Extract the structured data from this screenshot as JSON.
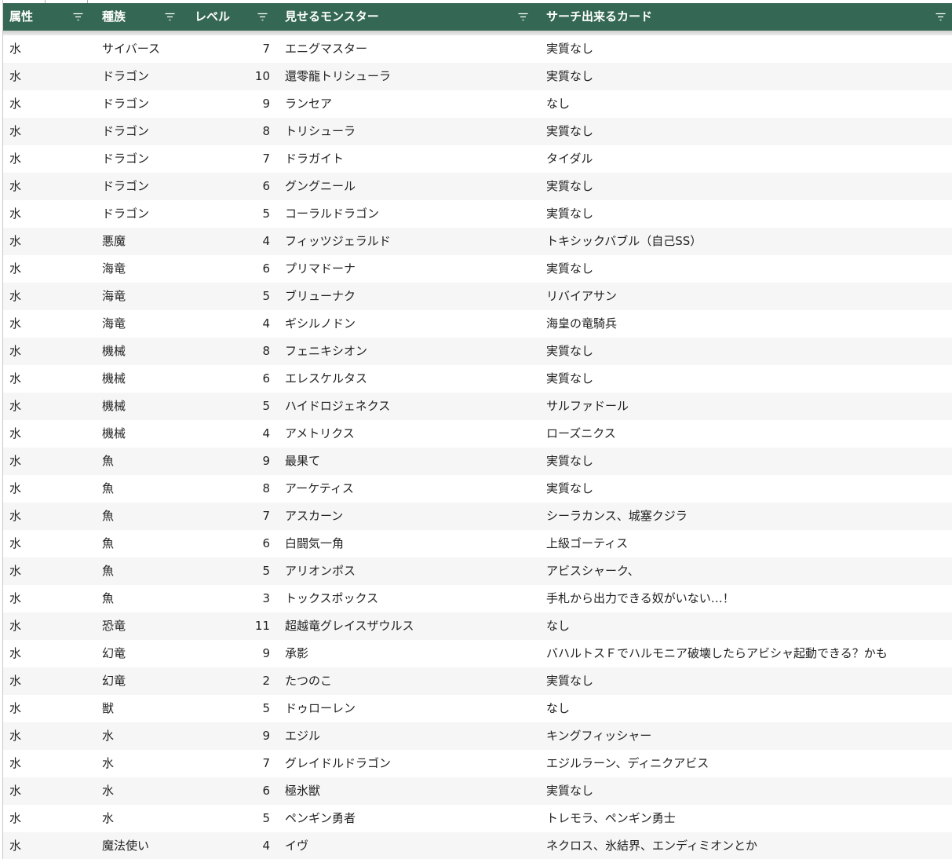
{
  "colors": {
    "header_bg": "#356854",
    "header_text": "#ffffff",
    "row_alt_bg": "#f5f6f5",
    "cell_text": "#222222"
  },
  "icons": {
    "filter": "filter-icon"
  },
  "table": {
    "columns": [
      {
        "key": "attribute",
        "label": "属性"
      },
      {
        "key": "type",
        "label": "種族"
      },
      {
        "key": "level",
        "label": "レベル"
      },
      {
        "key": "reveal_monster",
        "label": "見せるモンスター"
      },
      {
        "key": "searchable_card",
        "label": "サーチ出来るカード"
      }
    ],
    "rows": [
      {
        "attribute": "水",
        "type": "サイバース",
        "level": "7",
        "reveal_monster": "エニグマスター",
        "searchable_card": "実質なし"
      },
      {
        "attribute": "水",
        "type": "ドラゴン",
        "level": "10",
        "reveal_monster": "還零龍トリシューラ",
        "searchable_card": "実質なし"
      },
      {
        "attribute": "水",
        "type": "ドラゴン",
        "level": "9",
        "reveal_monster": "ランセア",
        "searchable_card": "なし"
      },
      {
        "attribute": "水",
        "type": "ドラゴン",
        "level": "8",
        "reveal_monster": "トリシューラ",
        "searchable_card": "実質なし"
      },
      {
        "attribute": "水",
        "type": "ドラゴン",
        "level": "7",
        "reveal_monster": "ドラガイト",
        "searchable_card": "タイダル"
      },
      {
        "attribute": "水",
        "type": "ドラゴン",
        "level": "6",
        "reveal_monster": "グングニール",
        "searchable_card": "実質なし"
      },
      {
        "attribute": "水",
        "type": "ドラゴン",
        "level": "5",
        "reveal_monster": "コーラルドラゴン",
        "searchable_card": "実質なし"
      },
      {
        "attribute": "水",
        "type": "悪魔",
        "level": "4",
        "reveal_monster": "フィッツジェラルド",
        "searchable_card": "トキシックバブル（自己SS）"
      },
      {
        "attribute": "水",
        "type": "海竜",
        "level": "6",
        "reveal_monster": "プリマドーナ",
        "searchable_card": "実質なし"
      },
      {
        "attribute": "水",
        "type": "海竜",
        "level": "5",
        "reveal_monster": "ブリューナク",
        "searchable_card": "リバイアサン"
      },
      {
        "attribute": "水",
        "type": "海竜",
        "level": "4",
        "reveal_monster": "ギシルノドン",
        "searchable_card": "海皇の竜騎兵"
      },
      {
        "attribute": "水",
        "type": "機械",
        "level": "8",
        "reveal_monster": "フェニキシオン",
        "searchable_card": "実質なし"
      },
      {
        "attribute": "水",
        "type": "機械",
        "level": "6",
        "reveal_monster": "エレスケルタス",
        "searchable_card": "実質なし"
      },
      {
        "attribute": "水",
        "type": "機械",
        "level": "5",
        "reveal_monster": "ハイドロジェネクス",
        "searchable_card": "サルファドール"
      },
      {
        "attribute": "水",
        "type": "機械",
        "level": "4",
        "reveal_monster": "アメトリクス",
        "searchable_card": "ローズニクス"
      },
      {
        "attribute": "水",
        "type": "魚",
        "level": "9",
        "reveal_monster": "最果て",
        "searchable_card": "実質なし"
      },
      {
        "attribute": "水",
        "type": "魚",
        "level": "8",
        "reveal_monster": "アーケティス",
        "searchable_card": "実質なし"
      },
      {
        "attribute": "水",
        "type": "魚",
        "level": "7",
        "reveal_monster": "アスカーン",
        "searchable_card": "シーラカンス、城塞クジラ"
      },
      {
        "attribute": "水",
        "type": "魚",
        "level": "6",
        "reveal_monster": "白闘気一角",
        "searchable_card": "上級ゴーティス"
      },
      {
        "attribute": "水",
        "type": "魚",
        "level": "5",
        "reveal_monster": "アリオンポス",
        "searchable_card": "アビスシャーク、"
      },
      {
        "attribute": "水",
        "type": "魚",
        "level": "3",
        "reveal_monster": "トックスポックス",
        "searchable_card": "手札から出力できる奴がいない…！"
      },
      {
        "attribute": "水",
        "type": "恐竜",
        "level": "11",
        "reveal_monster": "超越竜グレイスザウルス",
        "searchable_card": "なし"
      },
      {
        "attribute": "水",
        "type": "幻竜",
        "level": "9",
        "reveal_monster": "承影",
        "searchable_card": "バハルトスＦでハルモニア破壊したらアビシャ起動できる？かも"
      },
      {
        "attribute": "水",
        "type": "幻竜",
        "level": "2",
        "reveal_monster": "たつのこ",
        "searchable_card": "実質なし"
      },
      {
        "attribute": "水",
        "type": "獣",
        "level": "5",
        "reveal_monster": "ドゥローレン",
        "searchable_card": "なし"
      },
      {
        "attribute": "水",
        "type": "水",
        "level": "9",
        "reveal_monster": "エジル",
        "searchable_card": "キングフィッシャー"
      },
      {
        "attribute": "水",
        "type": "水",
        "level": "7",
        "reveal_monster": "グレイドルドラゴン",
        "searchable_card": "エジルラーン、ディニクアビス"
      },
      {
        "attribute": "水",
        "type": "水",
        "level": "6",
        "reveal_monster": "極氷獣",
        "searchable_card": "実質なし"
      },
      {
        "attribute": "水",
        "type": "水",
        "level": "5",
        "reveal_monster": "ペンギン勇者",
        "searchable_card": "トレモラ、ペンギン勇士"
      },
      {
        "attribute": "水",
        "type": "魔法使い",
        "level": "4",
        "reveal_monster": "イヴ",
        "searchable_card": "ネクロス、氷結界、エンディミオンとか"
      }
    ]
  }
}
